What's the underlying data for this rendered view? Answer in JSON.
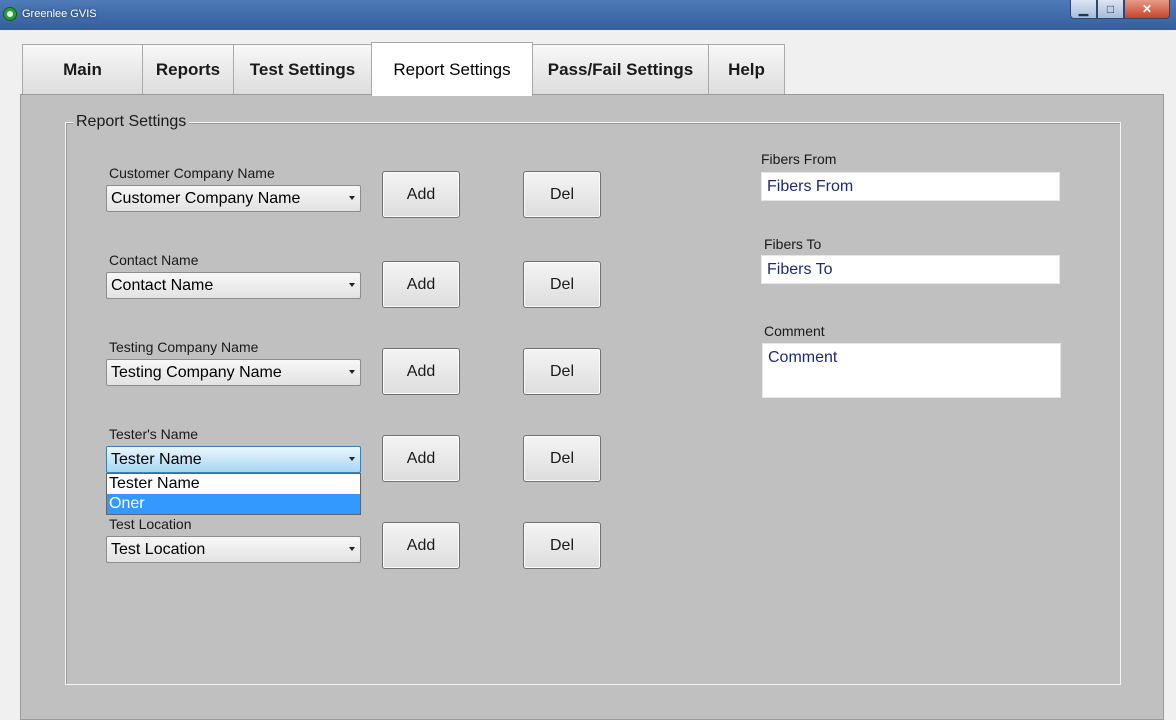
{
  "window": {
    "title": "Greenlee GVIS",
    "min_glyph": "▁",
    "max_glyph": "□",
    "close_glyph": "✕"
  },
  "tabs": [
    {
      "label": "Main"
    },
    {
      "label": "Reports"
    },
    {
      "label": "Test Settings"
    },
    {
      "label": "Report Settings",
      "active": true
    },
    {
      "label": "Pass/Fail Settings"
    },
    {
      "label": "Help"
    }
  ],
  "group": {
    "title": "Report Settings"
  },
  "fields": [
    {
      "label": "Customer Company Name",
      "value": "Customer Company Name",
      "add": "Add",
      "del": "Del"
    },
    {
      "label": "Contact Name",
      "value": "Contact Name",
      "add": "Add",
      "del": "Del"
    },
    {
      "label": "Testing Company Name",
      "value": "Testing Company Name",
      "add": "Add",
      "del": "Del"
    },
    {
      "label": "Tester's Name",
      "value": "Tester Name",
      "add": "Add",
      "del": "Del",
      "dropdown_options": [
        "Tester Name",
        "Oner"
      ],
      "highlighted_option": "Oner"
    },
    {
      "label": "Test Location",
      "value": "Test Location",
      "add": "Add",
      "del": "Del"
    }
  ],
  "right": {
    "fibers_from": {
      "label": "Fibers From",
      "value": "Fibers From"
    },
    "fibers_to": {
      "label": "Fibers To",
      "value": "Fibers To"
    },
    "comment": {
      "label": "Comment",
      "value": "Comment"
    }
  },
  "colors": {
    "titlebar": "#3f6aa8",
    "panel": "#c0c0c0",
    "selection": "#3399ff",
    "input_text": "#1c2a7a"
  }
}
